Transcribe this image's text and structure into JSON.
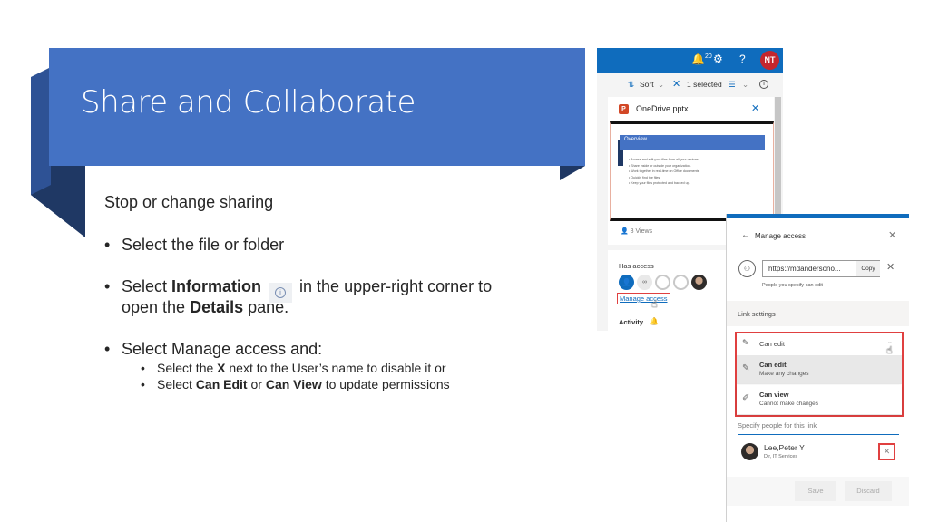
{
  "slide": {
    "title": "Share and Collaborate",
    "subhead": "Stop or change sharing",
    "bullets": [
      {
        "dot": "•",
        "text": "Select the file or folder"
      },
      {
        "dot": "•",
        "pre": "Select ",
        "bold1": "Information",
        "post": "in the upper-right corner to",
        "line2_pre": "open the ",
        "line2_bold": "Details",
        "line2_post": " pane.",
        "icon": "info-icon"
      },
      {
        "dot": "•",
        "text": "Select Manage access and:"
      }
    ],
    "sub_bullets": [
      {
        "dot": "•",
        "pre": "Select the ",
        "bold": "X",
        "post": " next to the User’s name to disable it or"
      },
      {
        "dot": "•",
        "pre": "Select ",
        "bold1": "Can Edit",
        "mid": " or ",
        "bold2": "Can View",
        "post": " to update permissions"
      }
    ],
    "colors": {
      "ribbon": "#4472c4",
      "ribbon_dark": "#1f3864",
      "ribbon_mid": "#2e5295"
    }
  },
  "onedrive_screenshot": {
    "topbar": {
      "notification_count": "20",
      "notification_icon": "bell-icon",
      "settings_icon": "gear-icon",
      "help": "?",
      "avatar_initials": "NT",
      "color": "#0f6cbd"
    },
    "commandbar": {
      "sort": "Sort",
      "selected": "1 selected",
      "info_icon": "i"
    },
    "details": {
      "filename": "OneDrive.pptx",
      "file_icon": "P",
      "thumbnail": {
        "title": "Overview",
        "lines": [
          "Access and edit your files from all your devices.",
          "Share inside or outside your organization.",
          "Work together in real-time on Office documents.",
          "Quickly find the files.",
          "Keep your files protected and backed up."
        ]
      },
      "views": "8 Views",
      "has_access": "Has access",
      "manage_access": "Manage access",
      "activity": "Activity"
    }
  },
  "manage_access_screenshot": {
    "title": "Manage access",
    "link_url": "https://mdandersono...",
    "copy_label": "Copy",
    "link_desc": "People you specify can edit",
    "link_settings": "Link settings",
    "permission_selected": "Can edit",
    "options": [
      {
        "title": "Can edit",
        "subtitle": "Make any changes",
        "icon": "pencil-icon"
      },
      {
        "title": "Can view",
        "subtitle": "Cannot make changes",
        "icon": "no-edit-icon"
      }
    ],
    "specify_placeholder": "Specify people for this link",
    "user": {
      "name": "Lee,Peter Y",
      "role": "Dir, IT Services"
    },
    "save_label": "Save",
    "discard_label": "Discard",
    "highlight_color": "#e04040"
  }
}
